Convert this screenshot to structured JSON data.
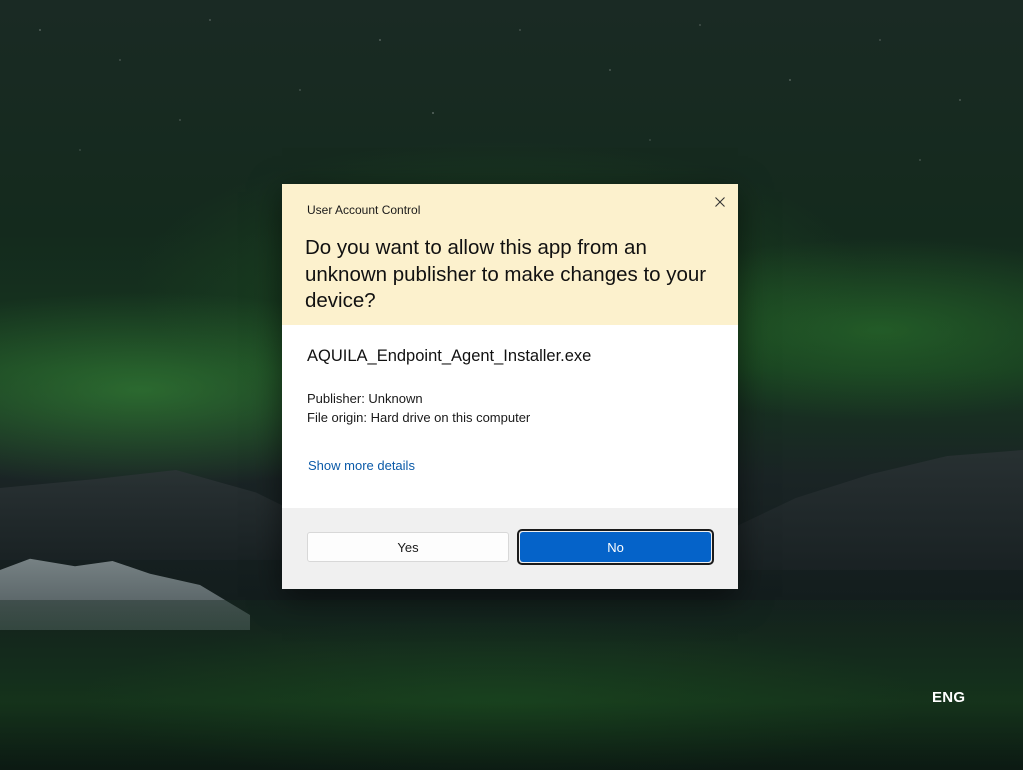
{
  "dialog": {
    "title": "User Account Control",
    "question": "Do you want to allow this app from an unknown publisher to make changes to your device?",
    "app_name": "AQUILA_Endpoint_Agent_Installer.exe",
    "publisher": "Publisher: Unknown",
    "file_origin": "File origin: Hard drive on this computer",
    "details_link": "Show more details",
    "yes_label": "Yes",
    "no_label": "No",
    "close_icon": "close-icon"
  },
  "system": {
    "language": "ENG"
  },
  "colors": {
    "header_background": "#fcf1cd",
    "primary_button": "#0563c9",
    "link": "#0b5aa8",
    "footer_background": "#f0f0f0"
  }
}
